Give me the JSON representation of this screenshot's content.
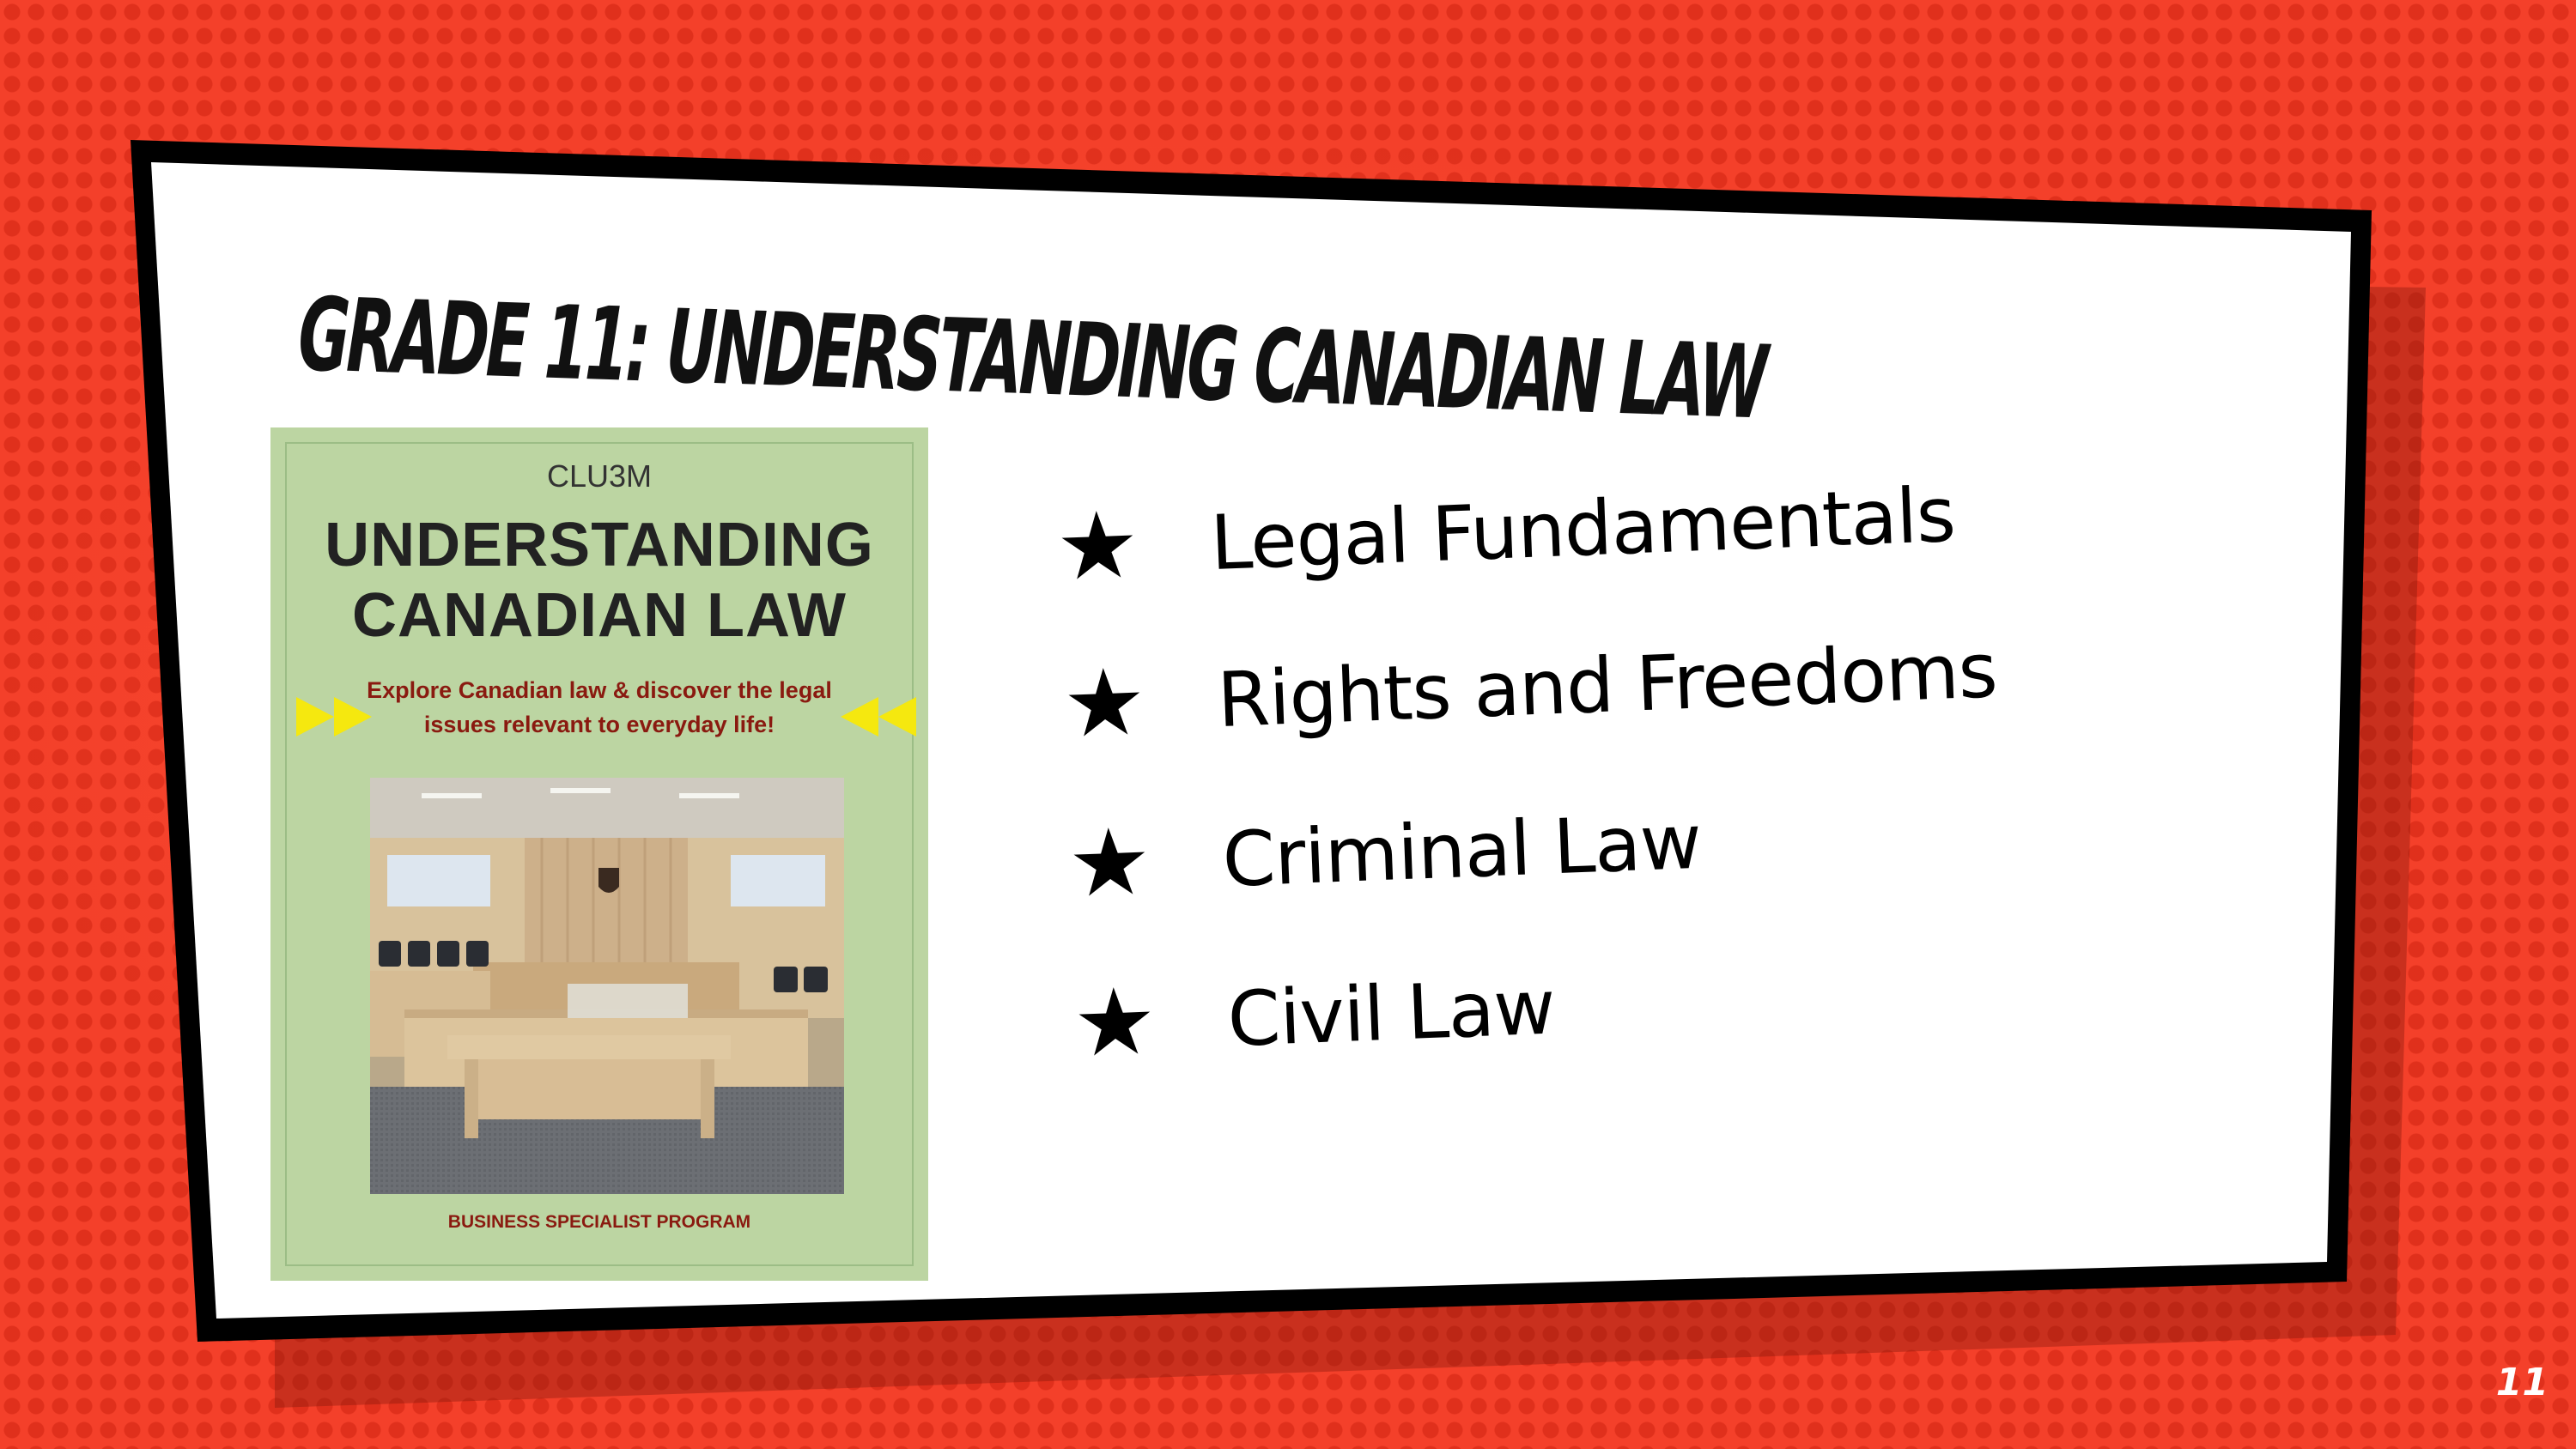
{
  "slide": {
    "title": "Grade 11:  Understanding Canadian Law",
    "page_number": "11"
  },
  "book": {
    "code": "CLU3M",
    "title_line1": "UNDERSTANDING",
    "title_line2": "CANADIAN LAW",
    "tagline_line1": "Explore Canadian law & discover the legal",
    "tagline_line2": "issues relevant to everyday life!",
    "footer": "BUSINESS SPECIALIST  PROGRAM",
    "photo": "courtroom-photo"
  },
  "bullets": [
    {
      "icon": "star-icon",
      "label": "Legal Fundamentals"
    },
    {
      "icon": "star-icon",
      "label": "Rights and Freedoms"
    },
    {
      "icon": "star-icon",
      "label": "Criminal Law"
    },
    {
      "icon": "star-icon",
      "label": "Civil Law"
    }
  ],
  "colors": {
    "background": "#f4402a",
    "panel": "#ffffff",
    "book_cover": "#bcd5a2",
    "book_accent": "#8a1a10",
    "arrow": "#f5e80f"
  }
}
